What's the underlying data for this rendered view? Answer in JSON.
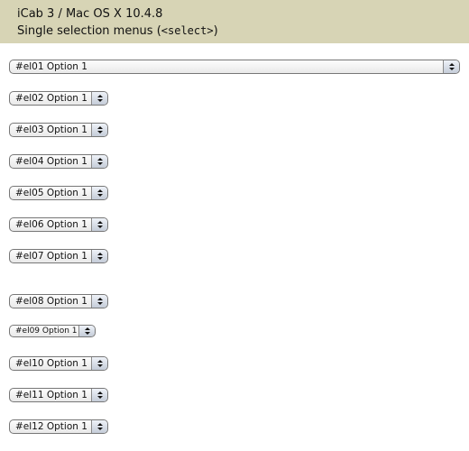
{
  "header": {
    "title": "iCab 3 / Mac OS X 10.4.8",
    "subtitle_prefix": "Single selection menus (",
    "subtitle_code": "<select>",
    "subtitle_suffix": ")"
  },
  "selects": [
    {
      "id": "#el01",
      "value": "#el01 Option 1"
    },
    {
      "id": "#el02",
      "value": "#el02 Option 1"
    },
    {
      "id": "#el03",
      "value": "#el03 Option 1"
    },
    {
      "id": "#el04",
      "value": "#el04 Option 1"
    },
    {
      "id": "#el05",
      "value": "#el05 Option 1"
    },
    {
      "id": "#el06",
      "value": "#el06 Option 1"
    },
    {
      "id": "#el07",
      "value": "#el07 Option 1"
    },
    {
      "id": "#el08",
      "value": "#el08 Option 1"
    },
    {
      "id": "#el09",
      "value": "#el09 Option 1"
    },
    {
      "id": "#el10",
      "value": "#el10 Option 1"
    },
    {
      "id": "#el11",
      "value": "#el11 Option 1"
    },
    {
      "id": "#el12",
      "value": "#el12 Option 1"
    }
  ]
}
